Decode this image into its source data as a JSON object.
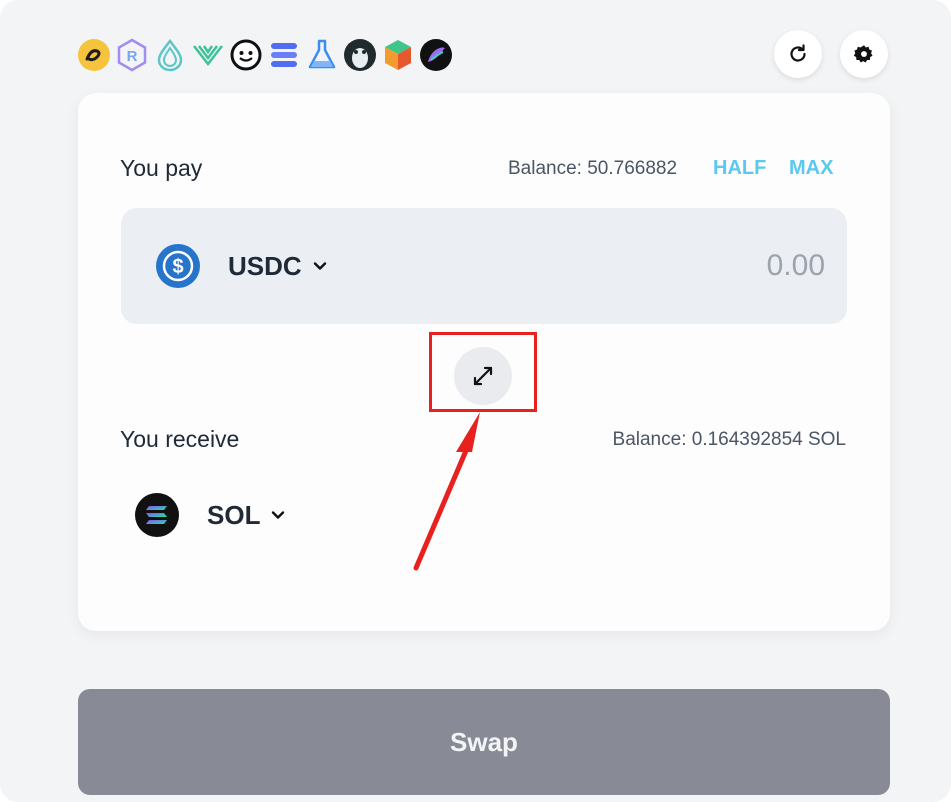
{
  "dex_icons": [
    "dex-logo-1-icon",
    "raydium-logo-icon",
    "drop-logo-icon",
    "wings-logo-icon",
    "smiley-logo-icon",
    "stripes-logo-icon",
    "flask-logo-icon",
    "penguin-logo-icon",
    "cube-logo-icon",
    "globe-logo-icon"
  ],
  "toolbar": {
    "refresh_icon": "refresh-icon",
    "settings_icon": "gear-icon"
  },
  "pay": {
    "label": "You pay",
    "balance": "Balance: 50.766882",
    "half_label": "HALF",
    "max_label": "MAX",
    "token": "USDC",
    "amount_placeholder": "0.00"
  },
  "receive": {
    "label": "You receive",
    "balance": "Balance: 0.164392854 SOL",
    "token": "SOL"
  },
  "swap_button": "Swap",
  "colors": {
    "accent": "#5ac8f0",
    "annotation": "#e8211e",
    "swap_button": "#888b96"
  }
}
